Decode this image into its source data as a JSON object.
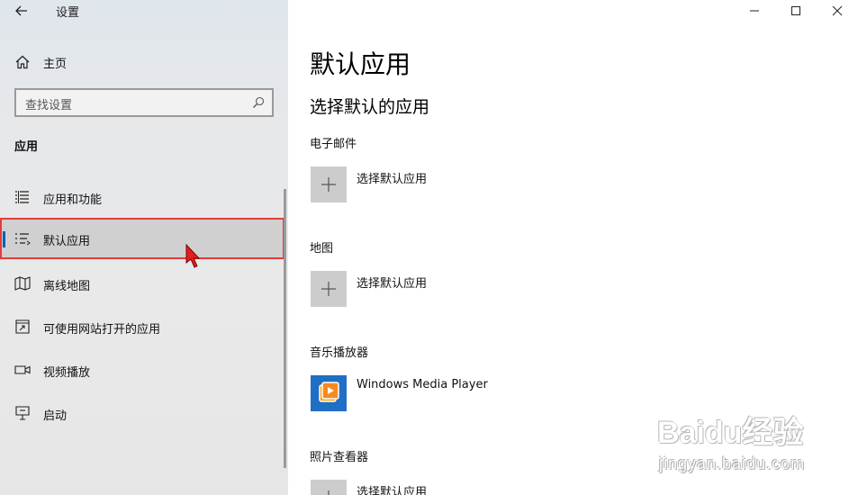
{
  "window": {
    "title": "设置",
    "back_icon": "arrow-left-icon",
    "controls": [
      "minimize-icon",
      "maximize-icon",
      "close-icon"
    ]
  },
  "sidebar": {
    "home_label": "主页",
    "search_placeholder": "查找设置",
    "section_title": "应用",
    "items": [
      {
        "label": "应用和功能",
        "icon": "list-icon"
      },
      {
        "label": "默认应用",
        "icon": "default-apps-icon",
        "selected": true
      },
      {
        "label": "离线地图",
        "icon": "map-icon"
      },
      {
        "label": "可使用网站打开的应用",
        "icon": "open-web-icon"
      },
      {
        "label": "视频播放",
        "icon": "video-icon"
      },
      {
        "label": "启动",
        "icon": "startup-icon"
      }
    ]
  },
  "main": {
    "title": "默认应用",
    "subtitle": "选择默认的应用",
    "categories": [
      {
        "label": "电子邮件",
        "app": "选择默认应用"
      },
      {
        "label": "地图",
        "app": "选择默认应用"
      },
      {
        "label": "音乐播放器",
        "app": "Windows Media Player"
      },
      {
        "label": "照片查看器",
        "app": "选择默认应用"
      }
    ]
  },
  "watermark": {
    "main": "Baidu经验",
    "sub": "jingyan.baidu.com"
  },
  "colors": {
    "accent": "#0063b1",
    "highlight_border": "#e53b3b",
    "wmp_tile": "#1f6fc4"
  }
}
